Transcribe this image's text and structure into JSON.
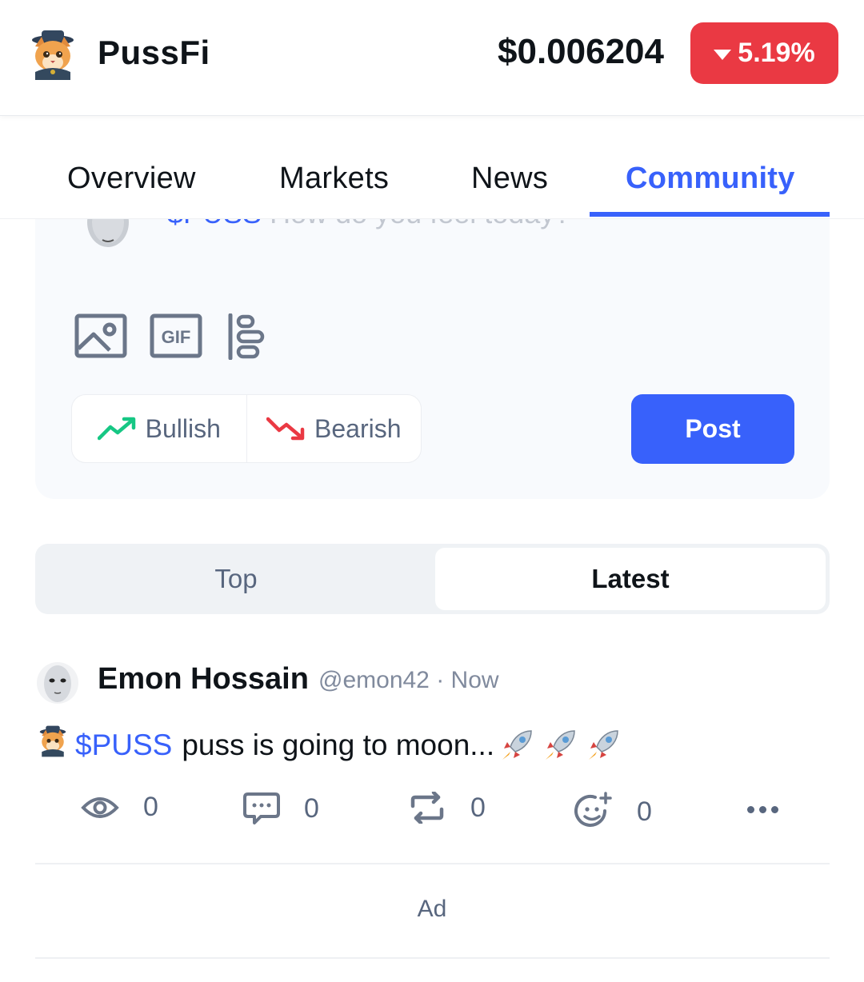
{
  "header": {
    "coin_name": "PussFi",
    "price": "$0.006204",
    "change": "5.19%",
    "change_direction": "down",
    "change_color": "#ea3943",
    "logo_icon": "cat-with-hat-logo"
  },
  "tabs": [
    {
      "label": "Overview",
      "active": false
    },
    {
      "label": "Markets",
      "active": false
    },
    {
      "label": "News",
      "active": false
    },
    {
      "label": "Community",
      "active": true
    }
  ],
  "compose": {
    "ticker": "$PUSS",
    "placeholder": "How do you feel today?",
    "tools": [
      "image-icon",
      "gif-icon",
      "poll-icon"
    ],
    "bullish_label": "Bullish",
    "bearish_label": "Bearish",
    "post_label": "Post"
  },
  "feed_filter": {
    "top_label": "Top",
    "latest_label": "Latest",
    "selected": "Latest"
  },
  "post": {
    "author": "Emon Hossain",
    "handle": "@emon42",
    "time": "Now",
    "ticker": "$PUSS",
    "text": "puss is going to moon...",
    "views": "0",
    "comments": "0",
    "reposts": "0",
    "reactions": "0"
  },
  "ad_label": "Ad",
  "colors": {
    "accent": "#3861fb",
    "bullish": "#16c784",
    "bearish": "#ea3943"
  }
}
